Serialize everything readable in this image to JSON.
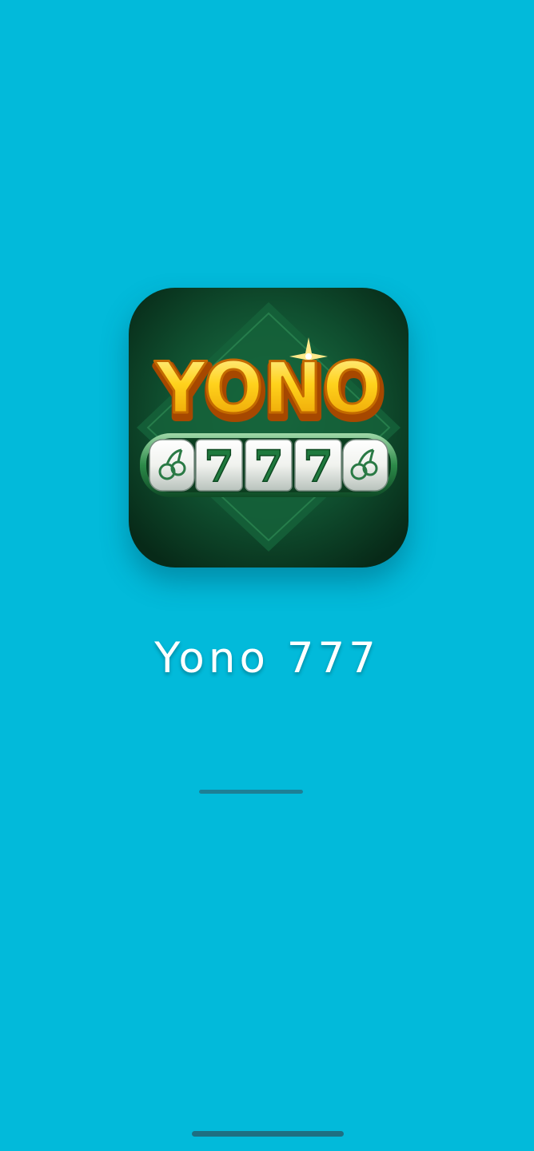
{
  "splash": {
    "background_color": "#02BADA",
    "app_name": "Yono 777",
    "logo": {
      "wordmark": "YONO",
      "reel_symbols": [
        "cherry",
        "7",
        "7",
        "7",
        "cherry"
      ],
      "icon_name": "yono-777-slot-logo"
    },
    "loading_progress": 1.0
  },
  "system": {
    "home_indicator": "home-indicator-bar"
  }
}
